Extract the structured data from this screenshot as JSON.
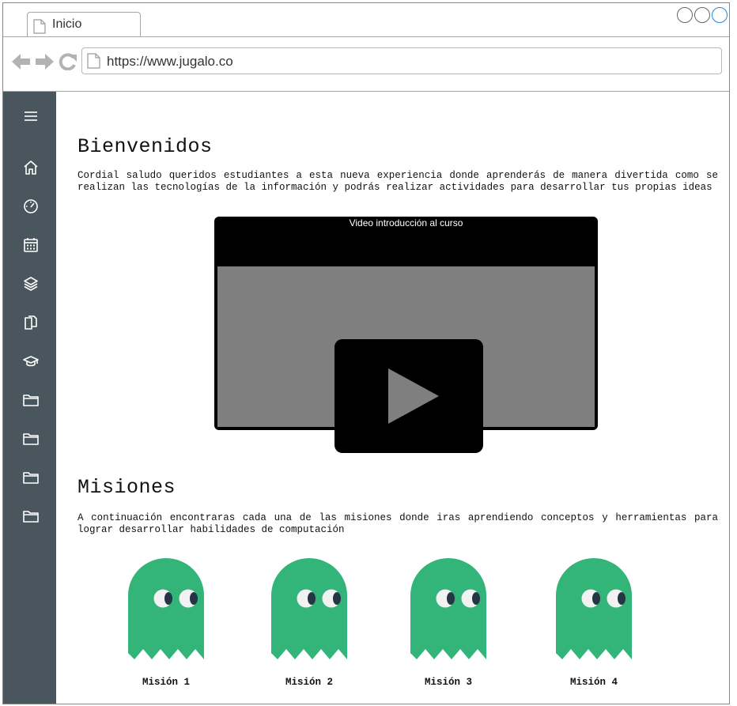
{
  "browser": {
    "tab_title": "Inicio",
    "url": "https://www.jugalo.co"
  },
  "sidebar": {
    "items": [
      {
        "icon": "menu-icon"
      },
      {
        "icon": "home-icon"
      },
      {
        "icon": "speedometer-icon"
      },
      {
        "icon": "calendar-icon"
      },
      {
        "icon": "layers-icon"
      },
      {
        "icon": "files-icon"
      },
      {
        "icon": "graduation-cap-icon"
      },
      {
        "icon": "folder-icon"
      },
      {
        "icon": "folder-icon"
      },
      {
        "icon": "folder-icon"
      },
      {
        "icon": "folder-icon"
      }
    ]
  },
  "welcome": {
    "title": "Bienvenidos",
    "text": "Cordial saludo queridos estudiantes a esta nueva experiencia donde aprenderás de manera divertida como se realizan las tecnologías de la información y podrás realizar actividades para desarrollar tus propias ideas"
  },
  "video": {
    "title": "Video introducción al curso"
  },
  "missions": {
    "title": "Misiones",
    "text": "A continuación encontraras cada una de las misiones donde iras aprendiendo conceptos y herramientas para lograr desarrollar habilidades de computación",
    "items": [
      {
        "label": "Misión 1"
      },
      {
        "label": "Misión 2"
      },
      {
        "label": "Misión 3"
      },
      {
        "label": "Misión 4"
      }
    ]
  },
  "colors": {
    "sidebar": "#4a565e",
    "ghost": "#33b57a"
  }
}
